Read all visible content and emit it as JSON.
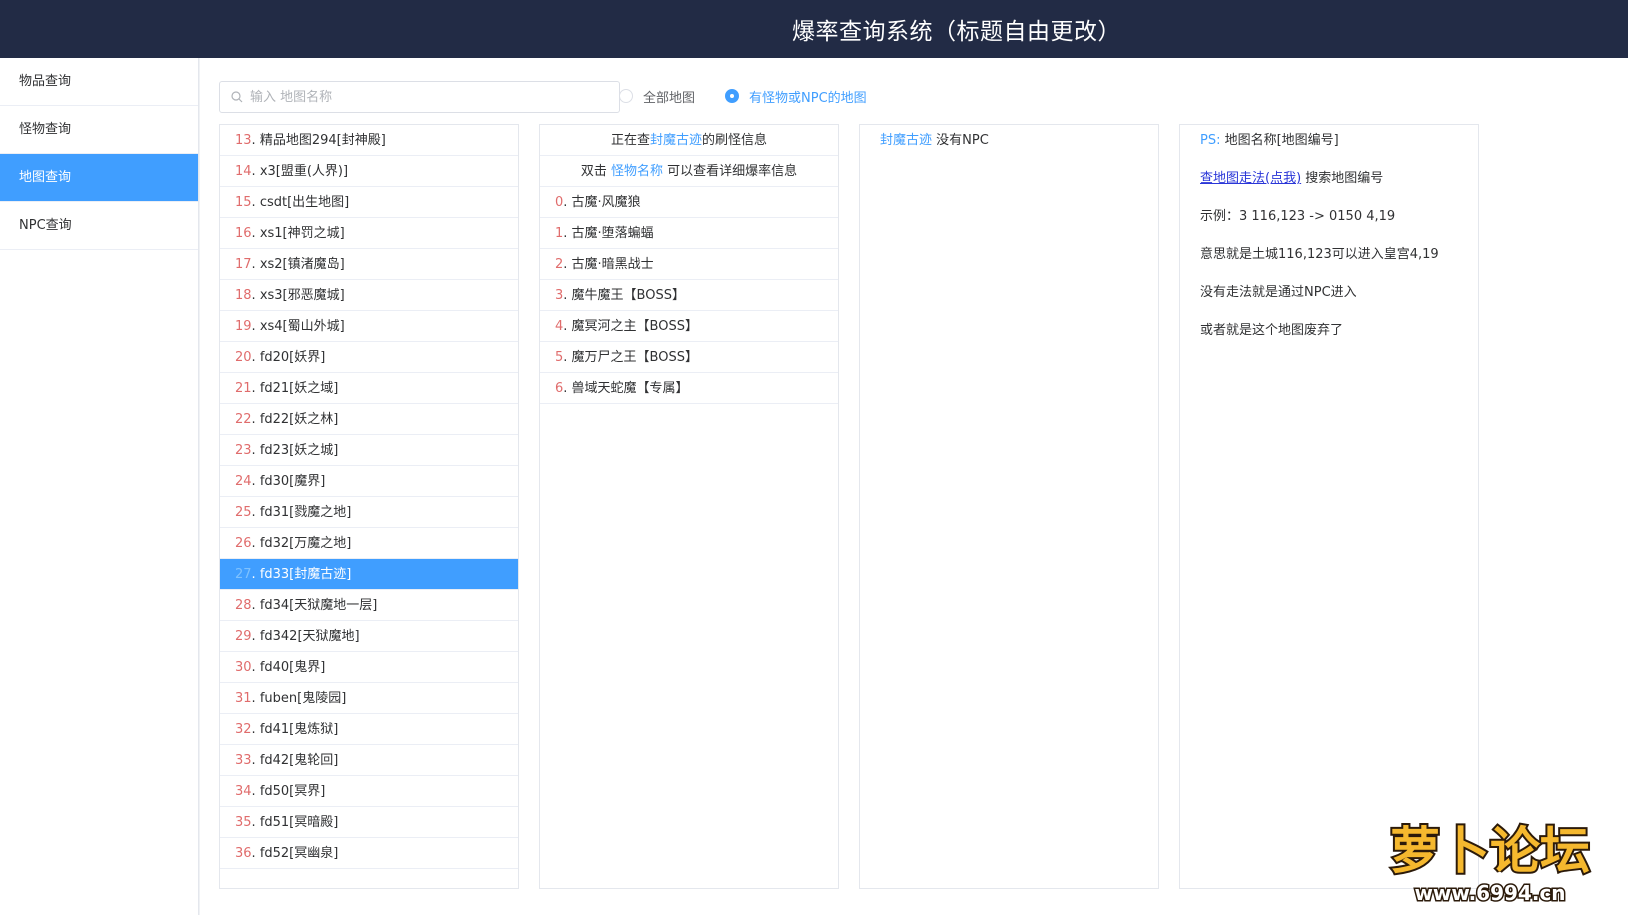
{
  "header": {
    "title": "爆率查询系统（标题自由更改）"
  },
  "sidebar": {
    "items": [
      {
        "label": "物品查询",
        "active": false
      },
      {
        "label": "怪物查询",
        "active": false
      },
      {
        "label": "地图查询",
        "active": true
      },
      {
        "label": "NPC查询",
        "active": false
      }
    ]
  },
  "search": {
    "placeholder": "输入 地图名称",
    "value": ""
  },
  "filters": {
    "all_maps": {
      "label": "全部地图",
      "checked": false
    },
    "with_monster_npc": {
      "label": "有怪物或NPC的地图",
      "checked": true
    }
  },
  "maps": [
    {
      "idx": "13",
      "name": "精品地图294[封神殿]"
    },
    {
      "idx": "14",
      "name": "x3[盟重(人界)]"
    },
    {
      "idx": "15",
      "name": "csdt[出生地图]"
    },
    {
      "idx": "16",
      "name": "xs1[神罚之城]"
    },
    {
      "idx": "17",
      "name": "xs2[镇渚魔岛]"
    },
    {
      "idx": "18",
      "name": "xs3[邪恶魔城]"
    },
    {
      "idx": "19",
      "name": "xs4[蜀山外城]"
    },
    {
      "idx": "20",
      "name": "fd20[妖界]"
    },
    {
      "idx": "21",
      "name": "fd21[妖之域]"
    },
    {
      "idx": "22",
      "name": "fd22[妖之林]"
    },
    {
      "idx": "23",
      "name": "fd23[妖之城]"
    },
    {
      "idx": "24",
      "name": "fd30[魔界]"
    },
    {
      "idx": "25",
      "name": "fd31[戮魔之地]"
    },
    {
      "idx": "26",
      "name": "fd32[万魔之地]"
    },
    {
      "idx": "27",
      "name": "fd33[封魔古迹]",
      "selected": true
    },
    {
      "idx": "28",
      "name": "fd34[天狱魔地一层]"
    },
    {
      "idx": "29",
      "name": "fd342[天狱魔地]"
    },
    {
      "idx": "30",
      "name": "fd40[鬼界]"
    },
    {
      "idx": "31",
      "name": "fuben[鬼陵园]"
    },
    {
      "idx": "32",
      "name": "fd41[鬼炼狱]"
    },
    {
      "idx": "33",
      "name": "fd42[鬼轮回]"
    },
    {
      "idx": "34",
      "name": "fd50[冥界]"
    },
    {
      "idx": "35",
      "name": "fd51[冥暗殿]"
    },
    {
      "idx": "36",
      "name": "fd52[冥幽泉]"
    }
  ],
  "monster_panel": {
    "header_prefix": "正在查",
    "map_name": "封魔古迹",
    "header_suffix": "的刷怪信息",
    "hint_prefix": "双击 ",
    "hint_link": "怪物名称",
    "hint_suffix": " 可以查看详细爆率信息",
    "monsters": [
      {
        "idx": "0",
        "name": "古魔·风魔狼"
      },
      {
        "idx": "1",
        "name": "古魔·堕落蝙蝠"
      },
      {
        "idx": "2",
        "name": "古魔·暗黑战士"
      },
      {
        "idx": "3",
        "name": "魔牛魔王【BOSS】"
      },
      {
        "idx": "4",
        "name": "魔冥河之主【BOSS】"
      },
      {
        "idx": "5",
        "name": "魔万尸之王【BOSS】"
      },
      {
        "idx": "6",
        "name": "兽域天蛇魔【专属】"
      }
    ]
  },
  "npc_panel": {
    "map_name": "封魔古迹",
    "text": " 没有NPC"
  },
  "ps_panel": {
    "ps_label": "PS: ",
    "ps_text": "地图名称[地图编号]",
    "link": "查地图走法(点我)",
    "link_suffix": " 搜索地图编号",
    "example": "示例：3 116,123 -> 0150 4,19",
    "meaning": "意思就是土城116,123可以进入皇宫4,19",
    "no_route": "没有走法就是通过NPC进入",
    "abandoned": "或者就是这个地图废弃了"
  },
  "watermark": {
    "brand": "萝卜论坛",
    "url": "www.6994.cn"
  },
  "colors": {
    "header_bg": "#222b45",
    "accent": "#409eff",
    "index_red": "#e06c6c",
    "link": "#2a36d8"
  }
}
